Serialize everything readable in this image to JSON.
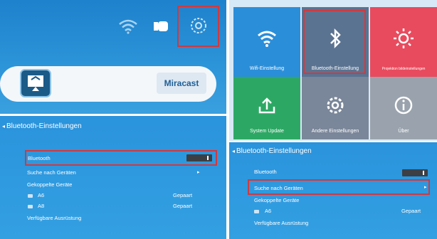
{
  "home": {
    "miracast_label": "Miracast",
    "icons": [
      "wifi-icon",
      "battery-icon",
      "gear-icon",
      "cast-screen-icon"
    ]
  },
  "settings_grid": {
    "tiles": [
      {
        "label": "Wifi-Einstellung",
        "icon": "wifi-icon",
        "color": "#2b8ed9"
      },
      {
        "label": "Bluetooth-Einstellung",
        "icon": "bluetooth-icon",
        "color": "#5a7391"
      },
      {
        "label": "Projektion bildeinstellungen",
        "icon": "sun-icon",
        "color": "#e84b5e"
      },
      {
        "label": "System Update",
        "icon": "upload-icon",
        "color": "#2da864"
      },
      {
        "label": "Andere Einstellungen",
        "icon": "gear-icon",
        "color": "#7a8699"
      },
      {
        "label": "Über",
        "icon": "info-icon",
        "color": "#9aa3ad"
      }
    ]
  },
  "bt_left": {
    "title": "Bluetooth-Einstellungen",
    "bluetooth": "Bluetooth",
    "search": "Suche nach Geräten",
    "paired_header": "Gekoppelte Geräte",
    "devices": [
      {
        "name": "A6",
        "status": "Gepaart"
      },
      {
        "name": "A8",
        "status": "Gepaart"
      }
    ],
    "available": "Verfügbare Ausrüstung"
  },
  "bt_right": {
    "title": "Bluetooth-Einstellungen",
    "bluetooth": "Bluetooth",
    "search": "Suche nach Geräten",
    "paired_header": "Gekoppelte Geräte",
    "devices": [
      {
        "name": "A6",
        "status": "Gepaart"
      }
    ],
    "available": "Verfügbare Ausrüstung"
  },
  "colors": {
    "highlight": "#d0393f",
    "bg_blue": "#2a93dc"
  }
}
